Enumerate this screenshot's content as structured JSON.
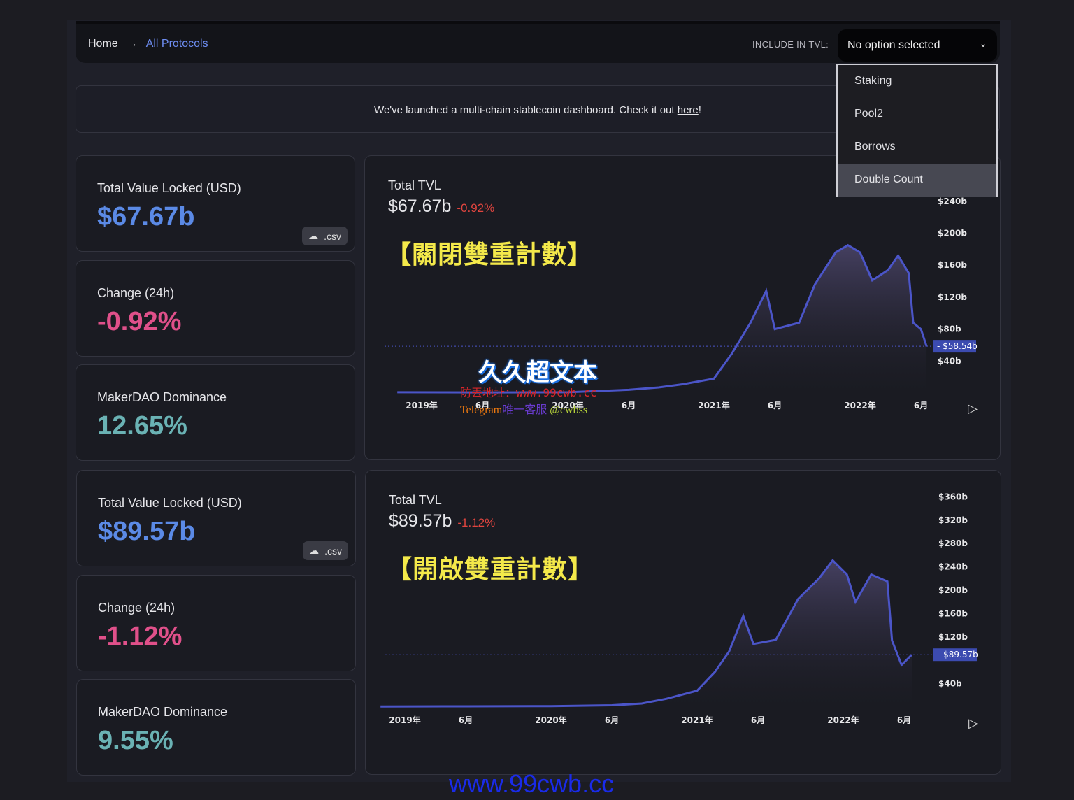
{
  "breadcrumb": {
    "home": "Home",
    "arrow": "→",
    "current": "All Protocols"
  },
  "filter": {
    "label": "INCLUDE IN TVL:",
    "value": "No option selected",
    "options": [
      "Staking",
      "Pool2",
      "Borrows",
      "Double Count"
    ],
    "highlighted": "Double Count"
  },
  "banner": {
    "text": "We've launched a multi-chain stablecoin dashboard. Check it out ",
    "link": "here",
    "suffix": "!"
  },
  "sections": [
    {
      "tvl_label": "Total Value Locked (USD)",
      "tvl": "$67.67b",
      "csv": ".csv",
      "change_label": "Change (24h)",
      "change": "-0.92%",
      "dom_label": "MakerDAO Dominance",
      "dominance": "12.65%",
      "chart_title": "Total TVL",
      "chart_value": "$67.67b",
      "chart_change": "-0.92%",
      "annotation": "【關閉雙重計數】",
      "current_label": "$58.54b"
    },
    {
      "tvl_label": "Total Value Locked (USD)",
      "tvl": "$89.57b",
      "csv": ".csv",
      "change_label": "Change (24h)",
      "change": "-1.12%",
      "dom_label": "MakerDAO Dominance",
      "dominance": "9.55%",
      "chart_title": "Total TVL",
      "chart_value": "$89.57b",
      "chart_change": "-1.12%",
      "annotation": "【開啟雙重計數】",
      "current_label": "$89.57b"
    }
  ],
  "watermarks": {
    "title": "久久超文本",
    "address": "防丟地址：www.99cwb.cc",
    "tg1": "Telegram",
    "tg2": "唯一客服",
    "tg3": "@cwbss",
    "footer": "www.99cwb.cc"
  },
  "colors": {
    "line": "#4b55c8",
    "accent": "#5b8ae6",
    "negative": "#e0508a"
  },
  "chart_data": [
    {
      "type": "area",
      "x_ticks": [
        "2019年",
        "6月",
        "2020年",
        "6月",
        "2021年",
        "6月",
        "2022年",
        "6月"
      ],
      "y_ticks": [
        "$40b",
        "$80b",
        "$120b",
        "$160b",
        "$200b",
        "$240b"
      ],
      "yunit": "$b",
      "ylim": [
        0,
        240
      ],
      "current": 58.54,
      "points": [
        [
          "2018-11-01",
          1
        ],
        [
          "2019-06-01",
          0.8
        ],
        [
          "2020-01-01",
          1
        ],
        [
          "2020-06-01",
          4
        ],
        [
          "2020-08-15",
          7
        ],
        [
          "2020-10-15",
          11
        ],
        [
          "2021-01-01",
          18
        ],
        [
          "2021-02-15",
          49
        ],
        [
          "2021-04-01",
          88
        ],
        [
          "2021-05-10",
          128
        ],
        [
          "2021-06-01",
          80
        ],
        [
          "2021-08-01",
          88
        ],
        [
          "2021-09-10",
          136
        ],
        [
          "2021-11-01",
          176
        ],
        [
          "2021-12-01",
          185
        ],
        [
          "2022-01-01",
          176
        ],
        [
          "2022-02-01",
          141
        ],
        [
          "2022-03-10",
          154
        ],
        [
          "2022-04-05",
          172
        ],
        [
          "2022-05-01",
          150
        ],
        [
          "2022-05-12",
          88
        ],
        [
          "2022-06-01",
          80
        ],
        [
          "2022-06-15",
          58.54
        ]
      ]
    },
    {
      "type": "area",
      "x_ticks": [
        "2019年",
        "6月",
        "2020年",
        "6月",
        "2021年",
        "6月",
        "2022年",
        "6月"
      ],
      "y_ticks": [
        "$40b",
        "$120b",
        "$160b",
        "$200b",
        "$240b",
        "$280b",
        "$320b",
        "$360b"
      ],
      "yunit": "$b",
      "ylim": [
        0,
        360
      ],
      "current": 89.57,
      "points": [
        [
          "2018-11-01",
          1
        ],
        [
          "2019-06-01",
          1.2
        ],
        [
          "2020-01-01",
          1.5
        ],
        [
          "2020-06-01",
          3
        ],
        [
          "2020-08-15",
          6
        ],
        [
          "2020-10-15",
          14
        ],
        [
          "2021-01-01",
          28
        ],
        [
          "2021-02-15",
          60
        ],
        [
          "2021-03-20",
          95
        ],
        [
          "2021-04-25",
          156
        ],
        [
          "2021-05-20",
          108
        ],
        [
          "2021-07-15",
          115
        ],
        [
          "2021-09-10",
          185
        ],
        [
          "2021-11-01",
          220
        ],
        [
          "2021-12-05",
          251
        ],
        [
          "2022-01-10",
          227
        ],
        [
          "2022-02-01",
          180
        ],
        [
          "2022-03-10",
          227
        ],
        [
          "2022-04-20",
          215
        ],
        [
          "2022-05-01",
          114
        ],
        [
          "2022-05-25",
          72
        ],
        [
          "2022-06-20",
          89.57
        ]
      ]
    }
  ]
}
